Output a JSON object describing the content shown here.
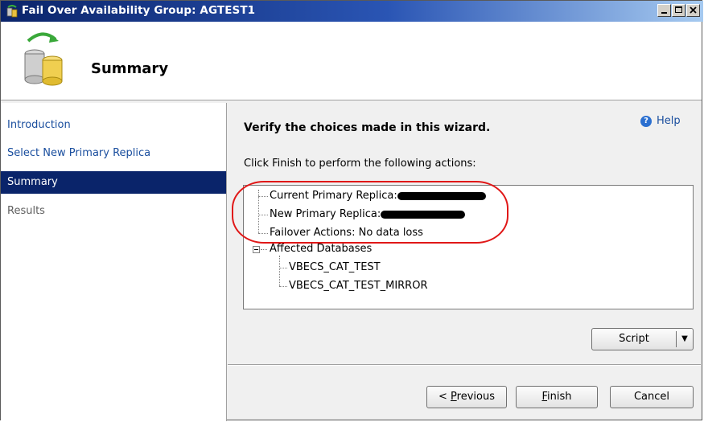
{
  "window": {
    "title": "Fail Over Availability Group: AGTEST1",
    "controls": [
      "minimize-icon",
      "maximize-icon",
      "close-icon"
    ]
  },
  "header": {
    "title": "Summary",
    "icon": "database-failover-icon"
  },
  "nav": {
    "items": [
      {
        "label": "Introduction",
        "state": "link"
      },
      {
        "label": "Select New Primary Replica",
        "state": "link"
      },
      {
        "label": "Summary",
        "state": "selected"
      },
      {
        "label": "Results",
        "state": "disabled"
      }
    ]
  },
  "help": {
    "label": "Help"
  },
  "main": {
    "heading": "Verify the choices made in this wizard.",
    "instruction": "Click Finish to perform the following actions:"
  },
  "tree": {
    "current_primary_label": "Current Primary Replica:",
    "new_primary_label": "New Primary Replica:",
    "failover_actions": "Failover Actions: No data loss",
    "affected_label": "Affected Databases",
    "databases": [
      "VBECS_CAT_TEST",
      "VBECS_CAT_TEST_MIRROR"
    ]
  },
  "buttons": {
    "script": "Script",
    "previous_mnemonic": "P",
    "previous_rest": "revious",
    "previous_prefix": "< ",
    "finish_mnemonic": "F",
    "finish_rest": "inish",
    "cancel": "Cancel"
  },
  "colors": {
    "accent": "#0a246a",
    "link": "#1a4e9e",
    "highlight": "#e01818"
  }
}
